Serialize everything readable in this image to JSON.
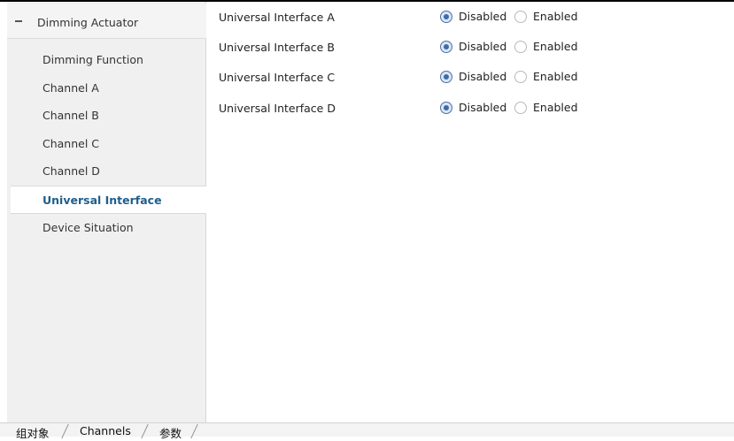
{
  "tree": {
    "root_label": "Dimming Actuator",
    "collapse_glyph": "−",
    "items": [
      {
        "label": "Dimming Function",
        "selected": false
      },
      {
        "label": "Channel A",
        "selected": false
      },
      {
        "label": "Channel B",
        "selected": false
      },
      {
        "label": "Channel C",
        "selected": false
      },
      {
        "label": "Channel D",
        "selected": false
      },
      {
        "label": "Universal Interface",
        "selected": true
      },
      {
        "label": "Device Situation",
        "selected": false
      }
    ]
  },
  "settings": {
    "rows": [
      {
        "label": "Universal Interface A",
        "options": [
          "Disabled",
          "Enabled"
        ],
        "selected": "Disabled"
      },
      {
        "label": "Universal Interface B",
        "options": [
          "Disabled",
          "Enabled"
        ],
        "selected": "Disabled"
      },
      {
        "label": "Universal Interface C",
        "options": [
          "Disabled",
          "Enabled"
        ],
        "selected": "Disabled"
      },
      {
        "label": "Universal Interface D",
        "options": [
          "Disabled",
          "Enabled"
        ],
        "selected": "Disabled"
      }
    ]
  },
  "bottom_tabs": {
    "items": [
      "组对象",
      "Channels",
      "参数"
    ]
  },
  "colors": {
    "accent": "#1f5e8c",
    "radio_checked": "#3e6aa8"
  }
}
